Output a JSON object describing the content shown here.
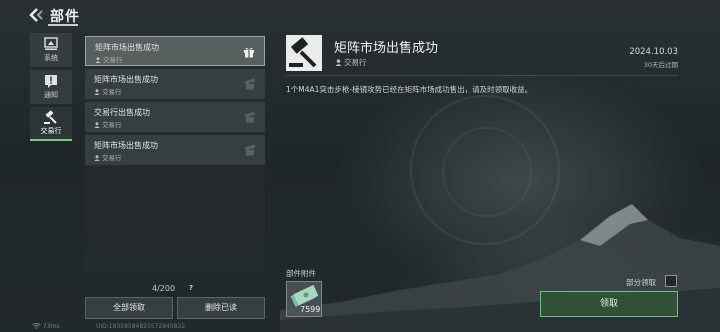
{
  "header": {
    "title": "部件"
  },
  "nav": {
    "items": [
      {
        "label": "系统",
        "icon": "system-icon",
        "active": false
      },
      {
        "label": "通知",
        "icon": "notice-icon",
        "active": false
      },
      {
        "label": "交易行",
        "icon": "gavel-icon",
        "active": true
      }
    ]
  },
  "mail_list": {
    "items": [
      {
        "title": "矩阵市场出售成功",
        "sender": "交易行",
        "has_gift": true,
        "selected": true
      },
      {
        "title": "矩阵市场出售成功",
        "sender": "交易行",
        "has_gift": false,
        "selected": false
      },
      {
        "title": "交易行出售成功",
        "sender": "交易行",
        "has_gift": false,
        "selected": false
      },
      {
        "title": "矩阵市场出售成功",
        "sender": "交易行",
        "has_gift": false,
        "selected": false
      }
    ],
    "count": "4/200",
    "help": "?",
    "claim_all_label": "全部领取",
    "delete_read_label": "删除已读"
  },
  "detail": {
    "title": "矩阵市场出售成功",
    "sender": "交易行",
    "date": "2024.10.03",
    "expire": "30天后过期",
    "body": "1个M4A1突击步枪-棱镜攻势已经在矩阵市场成功售出，请及时领取收益。",
    "attachment_label": "部件附件",
    "attachment_qty": "7599",
    "partial_claim_label": "部分领取",
    "claim_label": "领取"
  },
  "status_bar": {
    "ping": "73ms",
    "uid": "UID:18358584825572845832"
  },
  "colors": {
    "accent": "#79c98a",
    "claim_border": "#6fc27e"
  }
}
